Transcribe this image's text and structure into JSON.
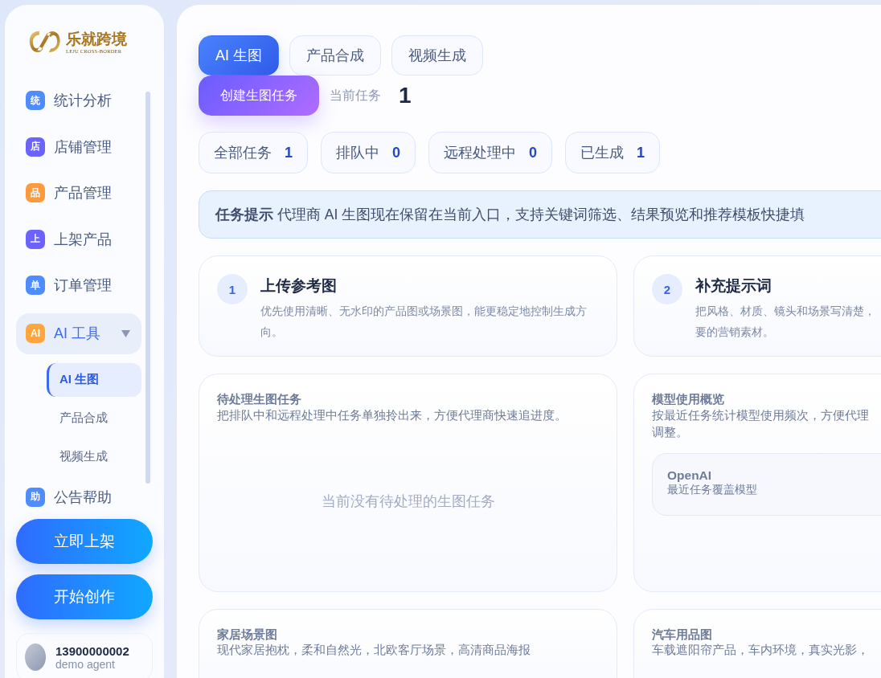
{
  "logo": {
    "name": "乐就跨境",
    "subtitle": "LEJU CROSS-BORDER"
  },
  "nav": [
    {
      "kind": "item",
      "badge": "统",
      "label": "统计分析",
      "color": "#4f8cff"
    },
    {
      "kind": "item",
      "badge": "店",
      "label": "店铺管理",
      "color": "#6c63ff"
    },
    {
      "kind": "item",
      "badge": "品",
      "label": "产品管理",
      "color": "#ff9a3c"
    },
    {
      "kind": "item",
      "badge": "上",
      "label": "上架产品",
      "color": "#6c63ff"
    },
    {
      "kind": "item",
      "badge": "单",
      "label": "订单管理",
      "color": "#4f8cff"
    },
    {
      "kind": "group",
      "badge": "AI",
      "label": "AI 工具",
      "color": "#ffa53c",
      "expanded": true,
      "children": [
        {
          "label": "AI 生图",
          "selected": true
        },
        {
          "label": "产品合成",
          "selected": false
        },
        {
          "label": "视频生成",
          "selected": false
        }
      ]
    },
    {
      "kind": "item",
      "badge": "助",
      "label": "公告帮助",
      "color": "#4f8cff"
    }
  ],
  "sidebar_buttons": [
    "立即上架",
    "开始创作"
  ],
  "user": {
    "phone": "13900000002",
    "name": "demo agent"
  },
  "tabs": [
    {
      "label": "AI 生图",
      "selected": true
    },
    {
      "label": "产品合成",
      "selected": false
    },
    {
      "label": "视频生成",
      "selected": false
    }
  ],
  "create_button": "创建生图任务",
  "current_task": {
    "label": "当前任务",
    "value": "1"
  },
  "stats": [
    {
      "label": "全部任务",
      "value": "1"
    },
    {
      "label": "排队中",
      "value": "0"
    },
    {
      "label": "远程处理中",
      "value": "0"
    },
    {
      "label": "已生成",
      "value": "1"
    }
  ],
  "notice": "**任务提示** 代理商 AI 生图现在保留在当前入口，支持关键词筛选、结果预览和推荐模板快捷填",
  "steps": [
    {
      "number": "1",
      "title": "上传参考图",
      "description": "优先使用清晰、无水印的产品图或场景图，能更稳定地控制生成方向。"
    },
    {
      "number": "2",
      "title": "补充提示词",
      "description": "把风格、材质、镜头和场景写清楚，要的营销素材。"
    }
  ],
  "pending_panel": {
    "title": "待处理生图任务",
    "description": "把排队中和远程处理中任务单独拎出来，方便代理商快速追进度。",
    "empty_text": "当前没有待处理的生图任务"
  },
  "model_panel": {
    "title": "模型使用概览",
    "description": "按最近任务统计模型使用频次，方便代理调整。",
    "models": [
      {
        "name": "OpenAI",
        "caption": "最近任务覆盖模型"
      }
    ]
  },
  "templates": [
    {
      "title": "家居场景图",
      "description": "现代家居抱枕，柔和自然光，北欧客厅场景，高清商品海报"
    },
    {
      "title": "汽车用品图",
      "description": "车载遮阳帘产品，车内环境，真实光影，"
    }
  ]
}
